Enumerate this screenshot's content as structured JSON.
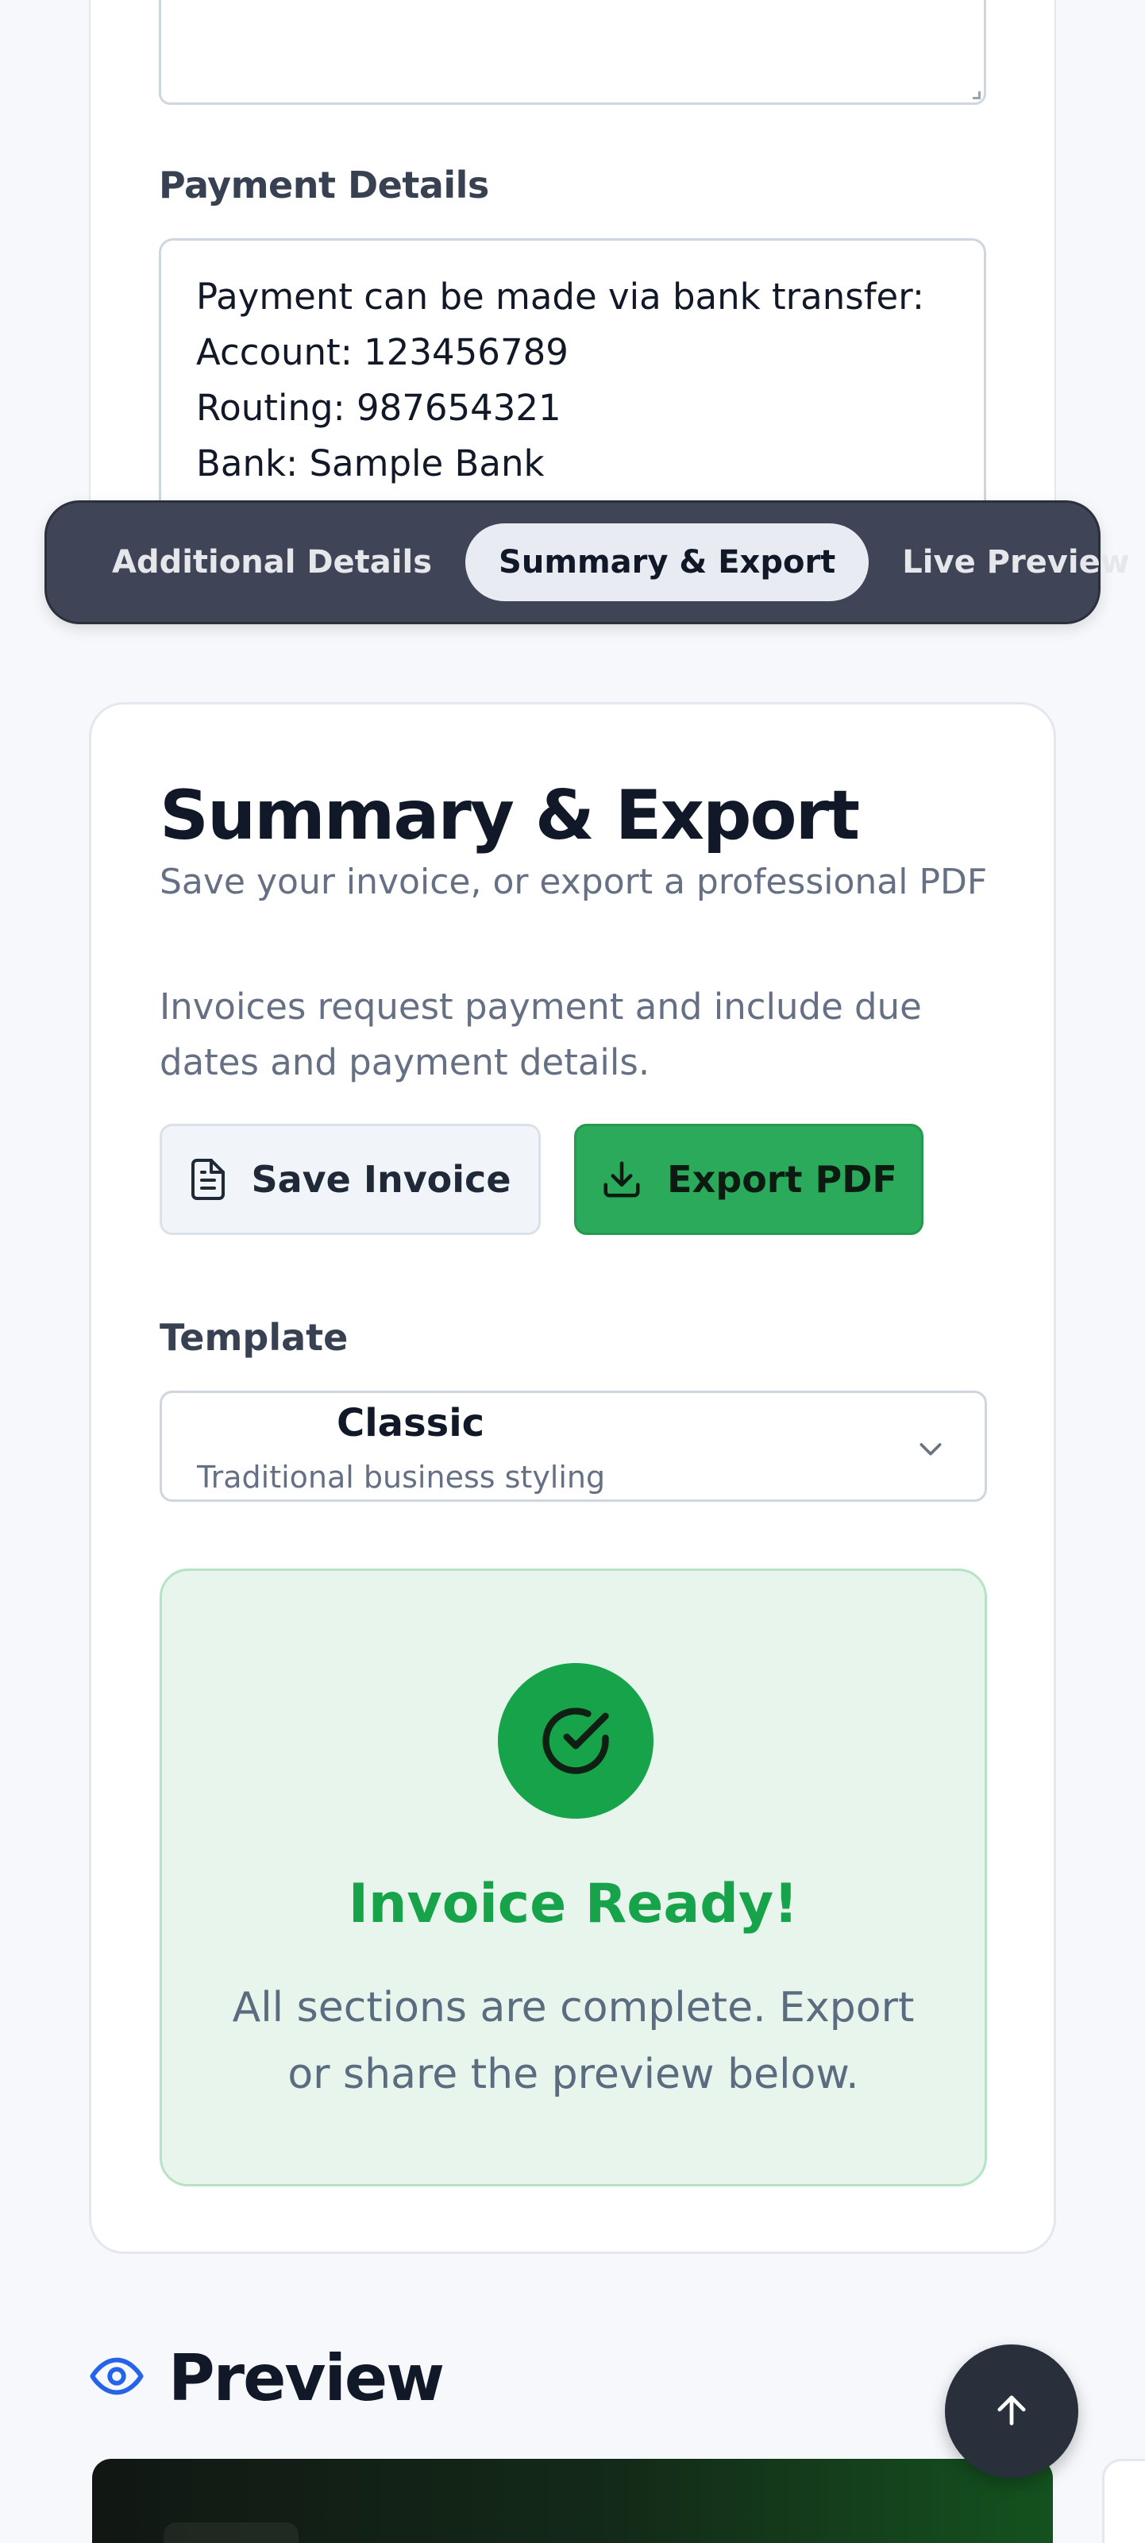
{
  "payment": {
    "label": "Payment Details",
    "lines": [
      "Payment can be made via bank transfer:",
      "Account: 123456789",
      "Routing: 987654321",
      "Bank: Sample Bank"
    ]
  },
  "tabs": [
    {
      "label": "Additional Details",
      "active": false
    },
    {
      "label": "Summary & Export",
      "active": true
    },
    {
      "label": "Live Preview",
      "active": false
    }
  ],
  "summary": {
    "title": "Summary & Export",
    "subtitle": "Save your invoice, or export a professional PDF",
    "description": "Invoices request payment and include due dates and payment details.",
    "save_label": "Save Invoice",
    "export_label": "Export PDF"
  },
  "template": {
    "label": "Template",
    "selected_name": "Classic",
    "selected_desc": "Traditional business styling"
  },
  "ready": {
    "title": "Invoice Ready!",
    "description": "All sections are complete. Export or share the preview below."
  },
  "preview": {
    "title": "Preview"
  },
  "colors": {
    "accent_green": "#16a34a",
    "export_green": "#2aaa5a",
    "tabbar_bg": "#3f4556",
    "preview_icon_blue": "#2563eb"
  },
  "icons": {
    "save": "document-icon",
    "export": "download-icon",
    "ready": "check-circle-icon",
    "preview": "eye-icon",
    "scroll_top": "arrow-up-icon",
    "select": "chevron-down-icon"
  }
}
